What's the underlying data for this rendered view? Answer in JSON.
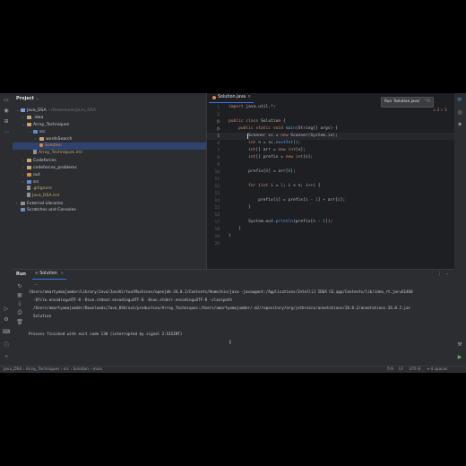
{
  "project": {
    "title": "Project",
    "tree": [
      {
        "depth": 0,
        "arrow": "⌄",
        "kind": "module",
        "label": "Java_DSA",
        "extra": "~/Downloads/Java_DSA"
      },
      {
        "depth": 1,
        "arrow": "›",
        "kind": "folder",
        "label": ".idea",
        "extra": ""
      },
      {
        "depth": 1,
        "arrow": "⌄",
        "kind": "folder",
        "label": "Array_Techniques",
        "extra": ""
      },
      {
        "depth": 2,
        "arrow": "⌄",
        "kind": "folder-blue",
        "label": "src",
        "extra": ""
      },
      {
        "depth": 3,
        "arrow": "›",
        "kind": "folder",
        "label": "wordsSearch",
        "extra": ""
      },
      {
        "depth": 3,
        "arrow": "",
        "kind": "java",
        "label": "Solution",
        "extra": ""
      },
      {
        "depth": 2,
        "arrow": "",
        "kind": "text",
        "label": "Array_Techniques.iml",
        "extra": ""
      },
      {
        "depth": 1,
        "arrow": "›",
        "kind": "folder",
        "label": "Codeforces",
        "extra": ""
      },
      {
        "depth": 1,
        "arrow": "›",
        "kind": "folder",
        "label": "codeforces_problems",
        "extra": ""
      },
      {
        "depth": 1,
        "arrow": "›",
        "kind": "folder-orange",
        "label": "out",
        "extra": ""
      },
      {
        "depth": 1,
        "arrow": "›",
        "kind": "folder-blue",
        "label": "src",
        "extra": ""
      },
      {
        "depth": 1,
        "arrow": "",
        "kind": "text",
        "label": ".gitignore",
        "extra": ""
      },
      {
        "depth": 1,
        "arrow": "",
        "kind": "text",
        "label": "Java_DSA.iml",
        "extra": ""
      },
      {
        "depth": 0,
        "arrow": "›",
        "kind": "lib",
        "label": "External Libraries",
        "extra": ""
      },
      {
        "depth": 0,
        "arrow": "",
        "kind": "scratch",
        "label": "Scratches and Consoles",
        "extra": ""
      }
    ]
  },
  "editor": {
    "tab": "Solution.java",
    "tab_close": "×",
    "run_tooltip": "Run 'Solution.java'",
    "run_shortcut": "^R",
    "inspections": "⚠ 2  ✓ 1",
    "lines": [
      {
        "n": "1",
        "text": "import java.util.*;"
      },
      {
        "n": "2",
        "text": ""
      },
      {
        "n": "3",
        "text": "public class Solution {"
      },
      {
        "n": "4",
        "text": "    public static void main(String[] args) {"
      },
      {
        "n": "5",
        "text": "        Scanner sc = new Scanner(System.in);"
      },
      {
        "n": "6",
        "text": "        int n = sc.nextInt();"
      },
      {
        "n": "7",
        "text": "        int[] arr = new int[n];"
      },
      {
        "n": "8",
        "text": "        int[] prefix = new int[n];"
      },
      {
        "n": "9",
        "text": ""
      },
      {
        "n": "10",
        "text": "        prefix[0] = arr[0];"
      },
      {
        "n": "11",
        "text": ""
      },
      {
        "n": "12",
        "text": "        for (int i = 1; i < n; i++) {"
      },
      {
        "n": "13",
        "text": ""
      },
      {
        "n": "14",
        "text": "            prefix[i] = prefix[i - 1] + arr[i];"
      },
      {
        "n": "15",
        "text": "        }"
      },
      {
        "n": "16",
        "text": ""
      },
      {
        "n": "17",
        "text": "        System.out.println(prefix[n - 1]);"
      },
      {
        "n": "18",
        "text": "    }"
      },
      {
        "n": "19",
        "text": "}"
      },
      {
        "n": "20",
        "text": ""
      }
    ]
  },
  "run": {
    "title": "Run",
    "tab": "Solution",
    "console": [
      "/Users/amartyamajumder/Library/Java/JavaVirtualMachines/openjdk-24.0.2/Contents/Home/bin/java -javaagent:/Applications/IntelliJ IDEA CE.app/Contents/lib/idea_rt.jar=61468",
      "  -Dfile.encoding=UTF-8 -Dsun.stdout.encoding=UTF-8 -Dsun.stderr.encoding=UTF-8 -classpath",
      "  /Users/amartyamajumder/Downloads/Java_DSA/out/production/Array_Techniques:/Users/amartyamajumder/.m2/repository/org/jetbrains/annotations/26.0.2/annotations-26.0.2.jar",
      "  Solution",
      "",
      "Process finished with exit code 130 (interrupted by signal 2:SIGINT)"
    ]
  },
  "statusbar": {
    "breadcrumbs": [
      "Java_DSA",
      "Array_Techniques",
      "src",
      "Solution",
      "main"
    ],
    "position": "5:9",
    "line_sep": "LF",
    "encoding": "UTF-8",
    "indent": "4 spaces"
  }
}
